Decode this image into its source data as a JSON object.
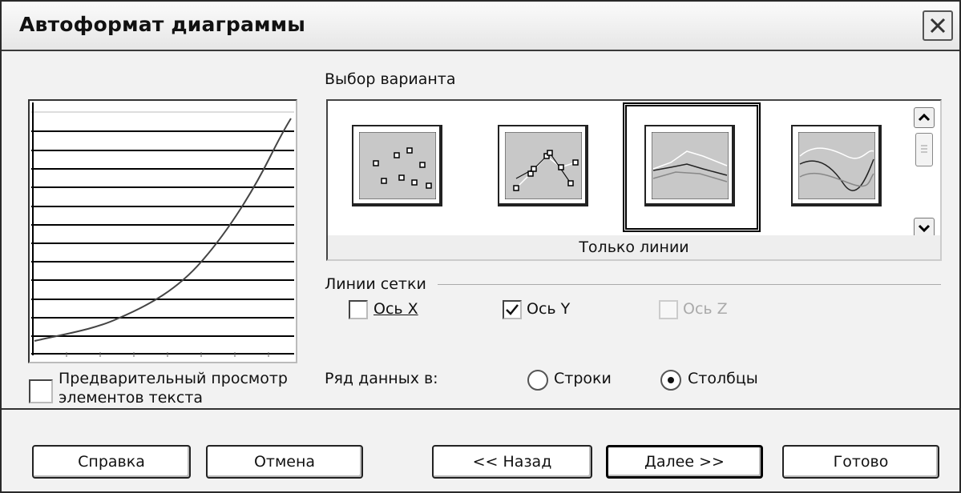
{
  "window": {
    "title": "Автоформат диаграммы"
  },
  "preview": {
    "checkbox_label_line1": "Предварительный просмотр",
    "checkbox_label_line2": "элементов текста",
    "checked": false
  },
  "variants": {
    "label": "Выбор варианта",
    "items": [
      {
        "icon": "points-only-chart-icon"
      },
      {
        "icon": "points-and-lines-chart-icon"
      },
      {
        "icon": "lines-only-chart-icon",
        "selected": true
      },
      {
        "icon": "smooth-lines-chart-icon"
      }
    ],
    "selected_caption": "Только линии"
  },
  "gridlines": {
    "label": "Линии сетки",
    "x_axis": {
      "label": "Ось X",
      "checked": false,
      "enabled": true
    },
    "y_axis": {
      "label": "Ось Y",
      "checked": true,
      "enabled": true
    },
    "z_axis": {
      "label": "Ось Z",
      "checked": false,
      "enabled": false
    }
  },
  "data_series": {
    "label": "Ряд данных в:",
    "rows": {
      "label": "Строки",
      "selected": false
    },
    "columns": {
      "label": "Столбцы",
      "selected": true
    }
  },
  "buttons": {
    "help": "Справка",
    "cancel": "Отмена",
    "back": "<< Назад",
    "next": "Далее >>",
    "finish": "Готово"
  }
}
